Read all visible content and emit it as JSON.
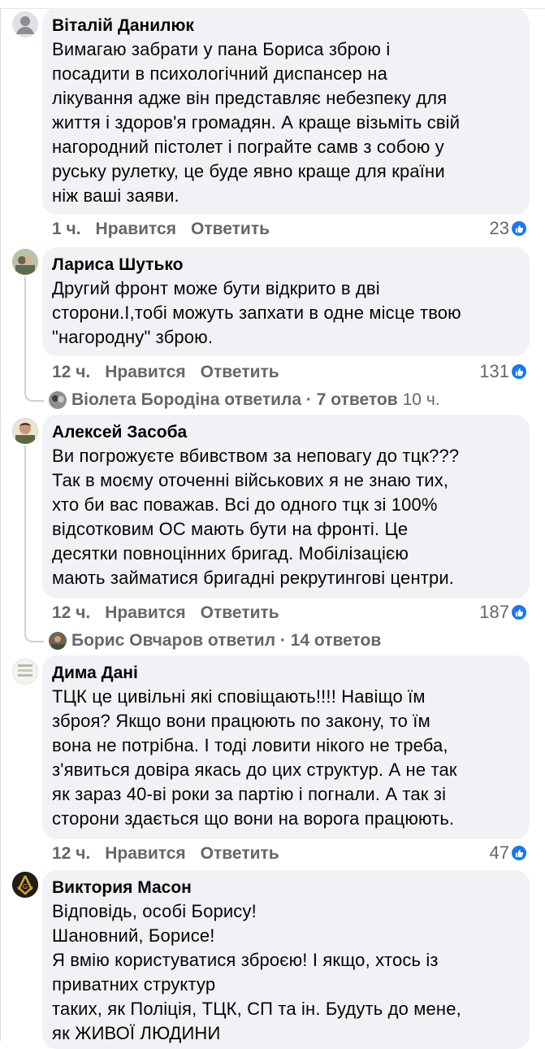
{
  "comments": [
    {
      "author": "Віталій Данилюк",
      "text": "Вимагаю забрати у пана Бориса зброю і\nпосадити в психологічний диспансер на\nлікування адже він представляє небезпеку для\nжиття і здоров'я громадян. А краще візьміть свій\nнагородний пістолет і пограйте самв з собою у\nруську рулетку, це буде явно краще для країни\nніж ваші заяви.",
      "time": "1 ч.",
      "like_label": "Нравится",
      "reply_label": "Ответить",
      "reactions": "23"
    },
    {
      "author": "Лариса Шутько",
      "text": "Другий фронт може бути відкрито в дві\nсторони.І,тобі можуть запхати в одне місце твою\n\"нагородну\" зброю.",
      "time": "12 ч.",
      "like_label": "Нравится",
      "reply_label": "Ответить",
      "reactions": "131",
      "replies_summary": "Віолета Бородіна ответила · 7 ответов",
      "replies_time": "10 ч."
    },
    {
      "author": "Алексей Засоба",
      "text": "Ви погрожуєте вбивством за неповагу до тцк???\nТак в моєму оточенні військових я не знаю тих,\nхто би вас поважав. Всі до одного тцк зі 100%\nвідсотковим ОС мають бути на фронті. Це\nдесятки повноцінних бригад. Мобілізацією\nмають займатися бригадні рекрутингові центри.",
      "time": "12 ч.",
      "like_label": "Нравится",
      "reply_label": "Ответить",
      "reactions": "187",
      "replies_summary": "Борис Овчаров ответил · 14 ответов"
    },
    {
      "author": "Дима Дані",
      "text": "ТЦК це цивільні які сповіщають!!!! Навіщо їм\nзброя? Якщо вони працюють по закону, то їм\nвона не потрібна. І тоді ловити нікого не треба,\nз'явиться довіра якась до цих структур. А не так\nяк зараз 40-ві роки за партію і погнали. А так зі\nсторони здається що вони на ворога працюють.",
      "time": "12 ч.",
      "like_label": "Нравится",
      "reply_label": "Ответить",
      "reactions": "47"
    },
    {
      "author": "Виктория Масон",
      "text": "Відповідь, особі Борису!\nШановний, Борисе!\nЯ вмію користуватися зброєю! І якщо, хтось із\nприватних структур\nтаких, як Поліція, ТЦК, СП та ін. Будуть до мене,\nяк ЖИВОЇ ЛЮДИНИ"
    }
  ],
  "colors": {
    "bubble": "#f0f2f5",
    "meta_text": "#65676b",
    "like_blue": "#1877f2"
  },
  "icons": {
    "like": "thumbs-up-icon",
    "default_avatar": "default-avatar-icon"
  }
}
